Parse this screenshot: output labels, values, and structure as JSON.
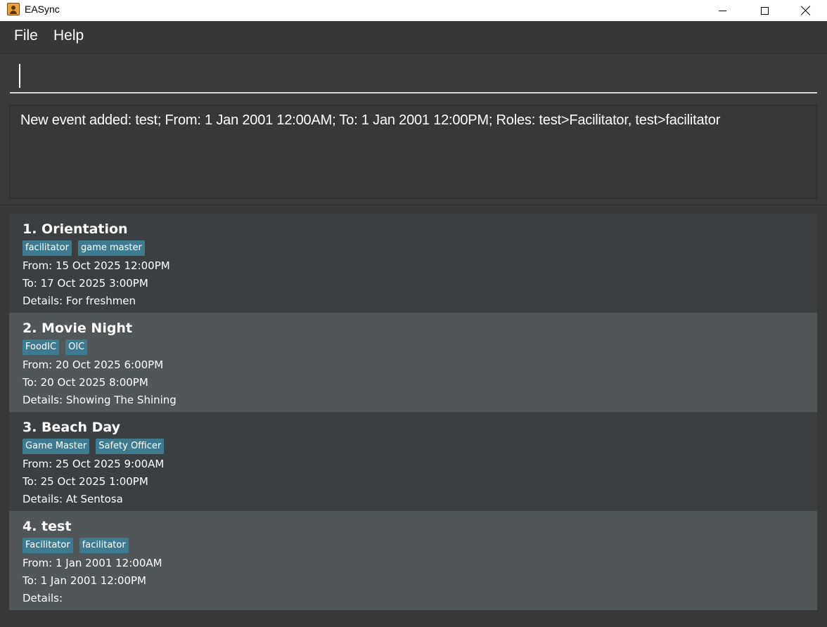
{
  "window": {
    "title": "EASync"
  },
  "menu": {
    "file": "File",
    "help": "Help"
  },
  "command": {
    "value": "",
    "placeholder": ""
  },
  "result": {
    "message": "New event added: test; From: 1 Jan 2001 12:00AM; To: 1 Jan 2001 12:00PM; Roles: test>Facilitator, test>facilitator"
  },
  "events": [
    {
      "title": "1. Orientation",
      "tags": [
        "facilitator",
        "game master"
      ],
      "from": "From: 15 Oct 2025 12:00PM",
      "to": "To: 17 Oct 2025 3:00PM",
      "details": "Details: For freshmen"
    },
    {
      "title": "2. Movie Night",
      "tags": [
        "FoodIC",
        "OIC"
      ],
      "from": "From: 20 Oct 2025 6:00PM",
      "to": "To: 20 Oct 2025 8:00PM",
      "details": "Details: Showing The Shining"
    },
    {
      "title": "3. Beach Day",
      "tags": [
        "Game Master",
        "Safety Officer"
      ],
      "from": "From: 25 Oct 2025 9:00AM",
      "to": "To: 25 Oct 2025 1:00PM",
      "details": "Details: At Sentosa"
    },
    {
      "title": "4. test",
      "tags": [
        "Facilitator",
        "facilitator"
      ],
      "from": "From: 1 Jan 2001 12:00AM",
      "to": "To: 1 Jan 2001 12:00PM",
      "details": "Details:"
    }
  ],
  "colors": {
    "tag_background": "#3e7b91",
    "card_odd": "#3c3f41",
    "card_even": "#515658"
  }
}
